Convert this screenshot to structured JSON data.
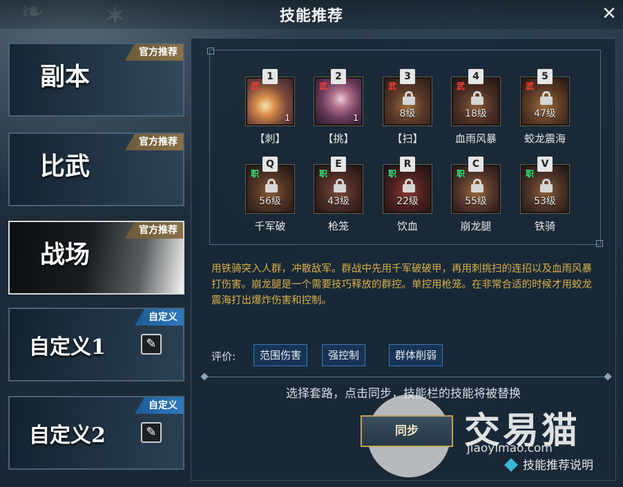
{
  "title": "技能推荐",
  "menu": [
    {
      "label": "副本",
      "tag": "官方推荐",
      "kind": "official",
      "active": false
    },
    {
      "label": "比武",
      "tag": "官方推荐",
      "kind": "official",
      "active": false
    },
    {
      "label": "战场",
      "tag": "官方推荐",
      "kind": "official",
      "active": true
    },
    {
      "label": "自定义1",
      "tag": "自定义",
      "kind": "custom",
      "active": false
    },
    {
      "label": "自定义2",
      "tag": "自定义",
      "kind": "custom",
      "active": false
    }
  ],
  "skills_row1": [
    {
      "key": "1",
      "badge": "武",
      "name": "【刺】",
      "count": "1",
      "level": "",
      "locked": false
    },
    {
      "key": "2",
      "badge": "武",
      "name": "【挑】",
      "count": "1",
      "level": "",
      "locked": false
    },
    {
      "key": "3",
      "badge": "武",
      "name": "【扫】",
      "count": "",
      "level": "8级",
      "locked": true
    },
    {
      "key": "4",
      "badge": "武",
      "name": "血雨风暴",
      "count": "",
      "level": "18级",
      "locked": true
    },
    {
      "key": "5",
      "badge": "武",
      "name": "蛟龙震海",
      "count": "",
      "level": "47级",
      "locked": true
    }
  ],
  "skills_row2": [
    {
      "key": "Q",
      "badge": "职",
      "name": "千军破",
      "level": "56级",
      "locked": true
    },
    {
      "key": "E",
      "badge": "职",
      "name": "枪笼",
      "level": "43级",
      "locked": true
    },
    {
      "key": "R",
      "badge": "职",
      "name": "饮血",
      "level": "22级",
      "locked": true
    },
    {
      "key": "C",
      "badge": "职",
      "name": "崩龙腿",
      "level": "55级",
      "locked": true
    },
    {
      "key": "V",
      "badge": "职",
      "name": "铁骑",
      "level": "53级",
      "locked": true
    }
  ],
  "description": "用铁骑突入人群，冲散敌军。群战中先用千军破破甲，再用刺挑扫的连招以及血雨风暴打伤害。崩龙腿是一个需要技巧释放的群控。单控用枪笼。在非常合适的时候才用蛟龙震海打出爆炸伤害和控制。",
  "rating": {
    "label": "评价:",
    "tags": [
      "范围伤害",
      "强控制",
      "群体削弱"
    ]
  },
  "hint": "选择套路，点击同步，技能栏的技能将被替换",
  "sync_label": "同步",
  "help_label": "技能推荐说明",
  "watermark": {
    "text": "交易猫",
    "url": "jiaoyimao.com"
  },
  "colors": {
    "desc": "#d9b04a",
    "tag_custom": "#2d7ac0",
    "tag_official": "#8a7248",
    "badge_wu": "#ff3a3a",
    "badge_zhi": "#2ee87a"
  }
}
